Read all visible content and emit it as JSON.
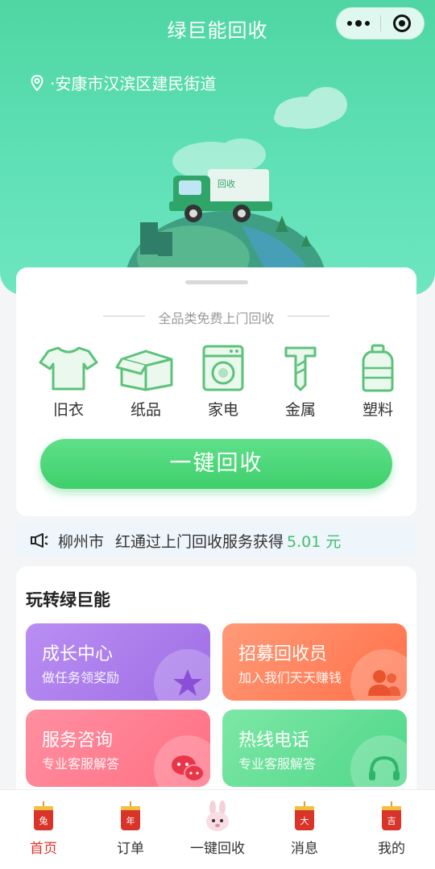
{
  "app": {
    "title": "绿巨能回收"
  },
  "location": {
    "text": "·安康市汉滨区建民街道"
  },
  "recycle_card": {
    "subtitle": "全品类免费上门回收",
    "categories": [
      {
        "label": "旧衣",
        "icon": "shirt-icon"
      },
      {
        "label": "纸品",
        "icon": "box-icon"
      },
      {
        "label": "家电",
        "icon": "washing-machine-icon"
      },
      {
        "label": "金属",
        "icon": "metal-icon"
      },
      {
        "label": "塑料",
        "icon": "bottle-icon"
      }
    ],
    "button_label": "一键回收"
  },
  "ticker": {
    "city": "柳州市",
    "message": "红通过上门回收服务获得",
    "amount": "5.01 元"
  },
  "play": {
    "title": "玩转绿巨能",
    "tiles": [
      {
        "title": "成长中心",
        "subtitle": "做任务领奖励",
        "icon": "star-icon"
      },
      {
        "title": "招募回收员",
        "subtitle": "加入我们天天赚钱",
        "icon": "people-icon"
      },
      {
        "title": "服务咨询",
        "subtitle": "专业客服解答",
        "icon": "chat-icon"
      },
      {
        "title": "热线电话",
        "subtitle": "专业客服解答",
        "icon": "headset-icon"
      }
    ]
  },
  "tabbar": {
    "items": [
      {
        "label": "首页",
        "badge": "兔"
      },
      {
        "label": "订单",
        "badge": "年"
      },
      {
        "label": "一键回收"
      },
      {
        "label": "消息",
        "badge": "大"
      },
      {
        "label": "我的",
        "badge": "吉"
      }
    ]
  },
  "colors": {
    "brand_green": "#4fd6a3",
    "button_green": "#3fcf6b",
    "active_tab": "#e0342a"
  }
}
